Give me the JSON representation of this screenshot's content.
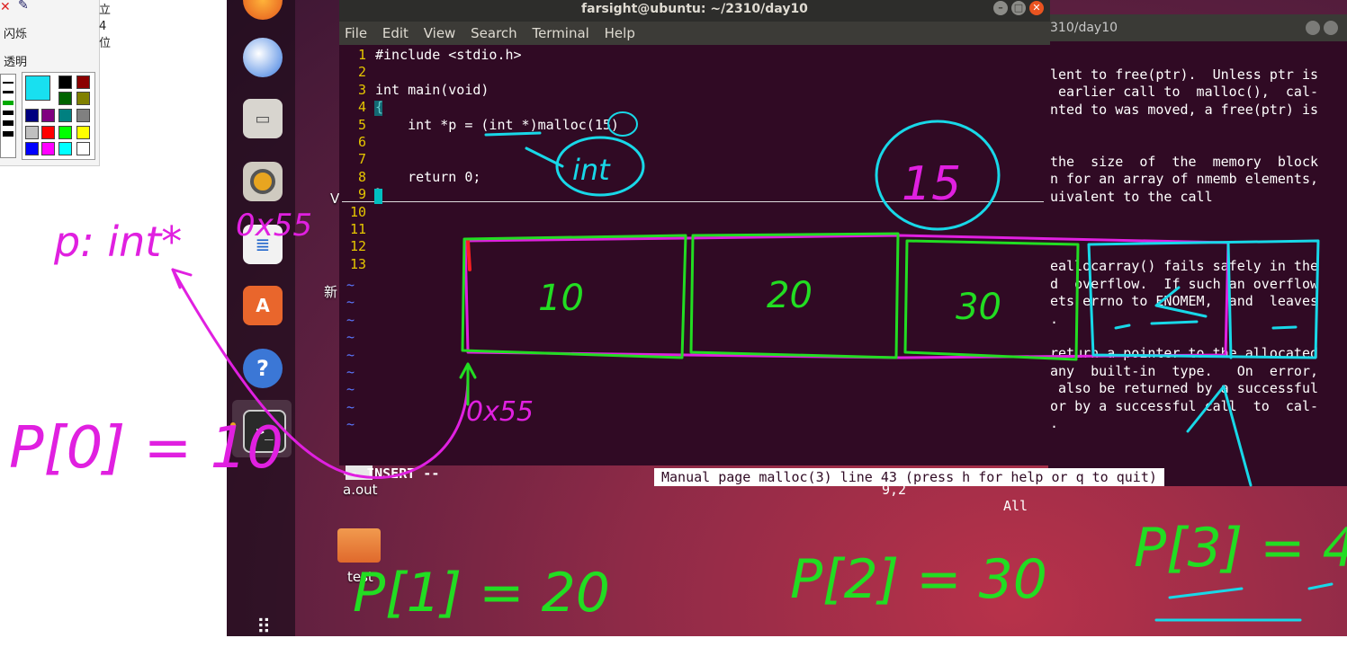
{
  "drawing_tool": {
    "row1": "立",
    "row2": "4 位",
    "blink": "闪烁",
    "transparent": "透明"
  },
  "desktop": {
    "side_text_1": "V",
    "side_text_2": "新",
    "aout_label": "a.out",
    "test_label": "test"
  },
  "terminal": {
    "title": "farsight@ubuntu: ~/2310/day10",
    "menu": [
      "File",
      "Edit",
      "View",
      "Search",
      "Terminal",
      "Help"
    ],
    "code_lines": [
      {
        "num": "1",
        "text": "#include <stdio.h>"
      },
      {
        "num": "2",
        "text": ""
      },
      {
        "num": "3",
        "text": "int main(void)"
      },
      {
        "num": "4",
        "text": "{"
      },
      {
        "num": "5",
        "text": "    int *p = (int *)malloc(15)"
      },
      {
        "num": "6",
        "text": ""
      },
      {
        "num": "7",
        "text": ""
      },
      {
        "num": "8",
        "text": "    return 0;"
      },
      {
        "num": "9",
        "text": "}"
      },
      {
        "num": "10",
        "text": ""
      },
      {
        "num": "11",
        "text": ""
      },
      {
        "num": "12",
        "text": ""
      },
      {
        "num": "13",
        "text": ""
      }
    ],
    "mode": "-- INSERT --",
    "position": "9,2",
    "scroll": "All"
  },
  "man_window": {
    "title": "310/day10",
    "lines": [
      "lent to free(ptr).  Unless ptr is",
      " earlier call to  malloc(),  cal-",
      "nted to was moved, a free(ptr) is",
      "",
      "",
      "the  size  of  the  memory  block",
      "n for an array of nmemb elements,",
      "uivalent to the call",
      "",
      "",
      "",
      "eallocarray() fails safely in the",
      "d  overflow.  If such an overflow",
      "ets errno to ENOMEM,  and  leaves",
      ".",
      "",
      "return a pointer to the allocated",
      "any  built-in  type.   On  error,",
      " also be returned by a successful",
      "or by a successful call  to  cal-",
      "."
    ],
    "status": "Manual page malloc(3) line 43 (press h for help or q to quit)"
  },
  "annotations": {
    "p_type": "p: int*",
    "addr_top": "0x55",
    "int_circle": "int",
    "size_circle": "15",
    "box1": "10",
    "box2": "20",
    "box3": "30",
    "addr_arrow": "0x55",
    "p0": "P[0] = 10",
    "p1": "P[1] = 20",
    "p2": "P[2] = 30",
    "p3": "P[3] = 4"
  },
  "colors": {
    "terminal_bg": "#300a24",
    "line_number": "#e5c600",
    "ink_green": "#22dd22",
    "ink_magenta": "#e020e0",
    "ink_cyan": "#18d8e8"
  }
}
